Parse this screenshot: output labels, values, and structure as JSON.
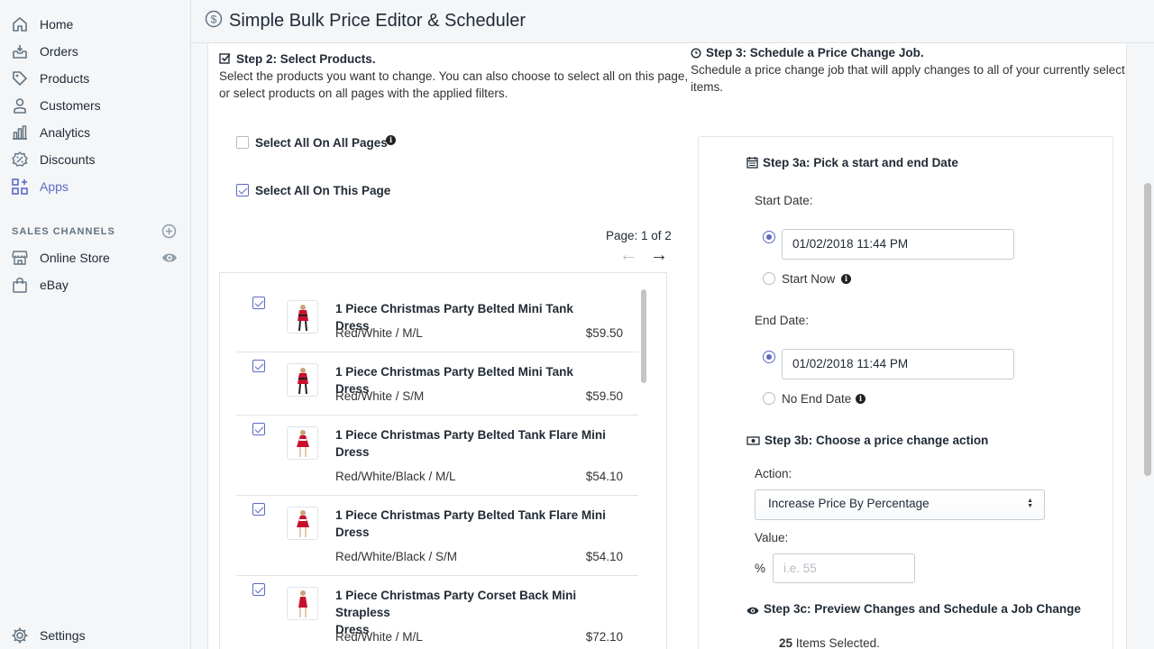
{
  "app": {
    "title": "Simple Bulk Price Editor & Scheduler"
  },
  "sidebar": {
    "items": [
      {
        "label": "Home",
        "icon": "home-icon"
      },
      {
        "label": "Orders",
        "icon": "orders-icon"
      },
      {
        "label": "Products",
        "icon": "tag-icon"
      },
      {
        "label": "Customers",
        "icon": "person-icon"
      },
      {
        "label": "Analytics",
        "icon": "bar-chart-icon"
      },
      {
        "label": "Discounts",
        "icon": "discount-icon"
      },
      {
        "label": "Apps",
        "icon": "apps-icon"
      }
    ],
    "sales_channels_heading": "SALES CHANNELS",
    "channels": [
      {
        "label": "Online Store",
        "icon": "store-icon"
      },
      {
        "label": "eBay",
        "icon": "bag-icon"
      }
    ],
    "settings_label": "Settings"
  },
  "step2": {
    "heading": "Step 2: Select Products.",
    "description_line1": "Select the products you want to change. You can also choose to select all on this page,",
    "description_line2": "or select products on all pages with the applied filters.",
    "select_all_pages_label": "Select All On All Pages",
    "select_all_page_label": "Select All On This Page",
    "pagination": "Page: 1 of 2"
  },
  "products": [
    {
      "title_line1": "1 Piece Christmas Party Belted Mini Tank Dress",
      "title_line2": "",
      "variant": "Red/White / M/L",
      "price": "$59.50"
    },
    {
      "title_line1": "1 Piece Christmas Party Belted Mini Tank Dress",
      "title_line2": "",
      "variant": "Red/White / S/M",
      "price": "$59.50"
    },
    {
      "title_line1": "1 Piece Christmas Party Belted Tank Flare Mini",
      "title_line2": "Dress",
      "variant": "Red/White/Black / M/L",
      "price": "$54.10"
    },
    {
      "title_line1": "1 Piece Christmas Party Belted Tank Flare Mini",
      "title_line2": "Dress",
      "variant": "Red/White/Black / S/M",
      "price": "$54.10"
    },
    {
      "title_line1": "1 Piece Christmas Party Corset Back Mini Strapless",
      "title_line2": "Dress",
      "variant": "Red/White / M/L",
      "price": "$72.10"
    }
  ],
  "step3": {
    "heading": "Step 3: Schedule a Price Change Job.",
    "description_line1": "Schedule a price change job that will apply changes to all of your currently select",
    "description_line2": "items.",
    "step3a_heading": "Step 3a: Pick a start and end Date",
    "start_date_label": "Start Date:",
    "start_date_value": "01/02/2018 11:44 PM",
    "start_now_label": "Start Now",
    "end_date_label": "End Date:",
    "end_date_value": "01/02/2018 11:44 PM",
    "no_end_date_label": "No End Date",
    "step3b_heading": "Step 3b: Choose a price change action",
    "action_label": "Action:",
    "action_value": "Increase Price By Percentage",
    "value_label": "Value:",
    "percent_symbol": "%",
    "value_placeholder": "i.e. 55",
    "step3c_heading": "Step 3c: Preview Changes and Schedule a Job Change",
    "items_selected_count": "25",
    "items_selected_text": "Items Selected."
  },
  "colors": {
    "accent": "#5c6ac4",
    "text": "#212b36",
    "sidebar_bg": "#f4f6f8"
  }
}
